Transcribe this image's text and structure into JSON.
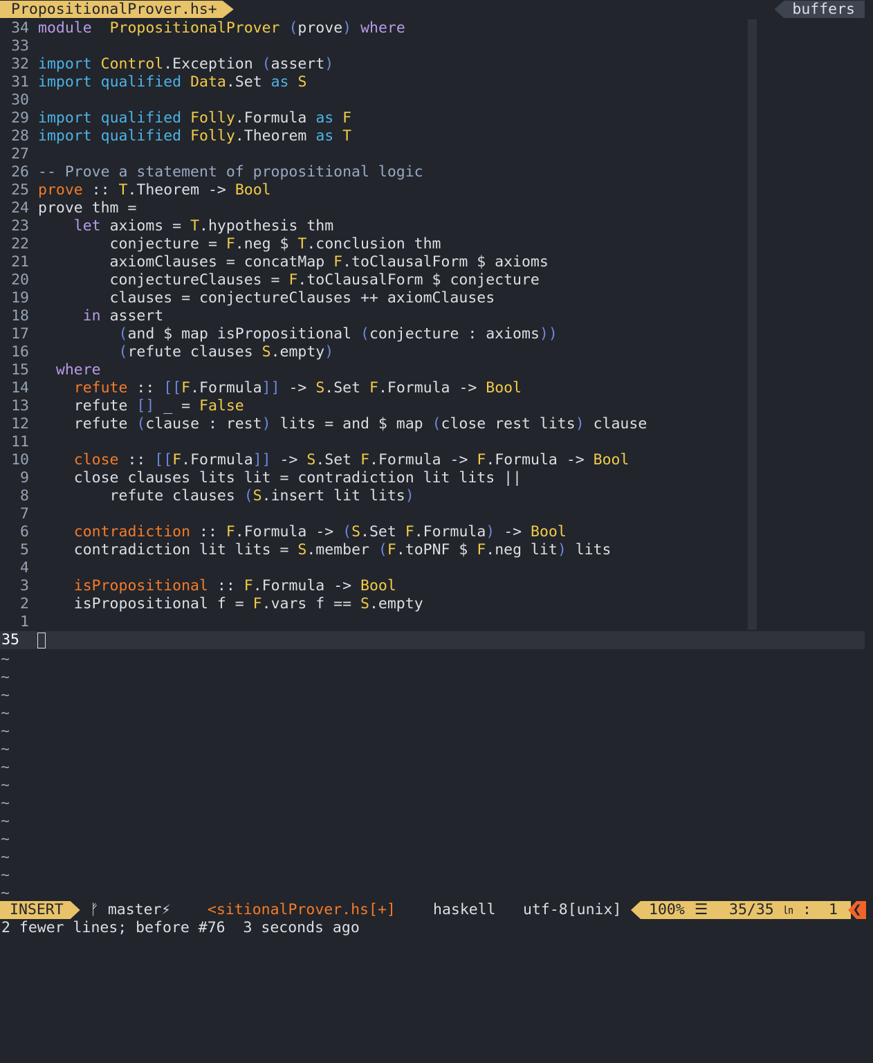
{
  "tabline": {
    "active_tab": "PropositionalProver.hs+",
    "buffers_label": "buffers"
  },
  "code": [
    {
      "ln": "34",
      "tokens": [
        [
          "kw",
          "module"
        ],
        [
          "",
          "  "
        ],
        [
          "ty",
          "PropositionalProver"
        ],
        [
          "",
          " "
        ],
        [
          "pu",
          "("
        ],
        [
          "",
          "prove"
        ],
        [
          "pu",
          ")"
        ],
        [
          "",
          " "
        ],
        [
          "kw",
          "where"
        ]
      ]
    },
    {
      "ln": "33",
      "tokens": []
    },
    {
      "ln": "32",
      "tokens": [
        [
          "im",
          "import"
        ],
        [
          "",
          " "
        ],
        [
          "ty",
          "Control"
        ],
        [
          "",
          ".Exception"
        ],
        [
          "",
          " "
        ],
        [
          "pu",
          "("
        ],
        [
          "",
          "assert"
        ],
        [
          "pu",
          ")"
        ]
      ]
    },
    {
      "ln": "31",
      "tokens": [
        [
          "im",
          "import"
        ],
        [
          "",
          " "
        ],
        [
          "im",
          "qualified"
        ],
        [
          "",
          " "
        ],
        [
          "ty",
          "Data"
        ],
        [
          "",
          ".Set"
        ],
        [
          "",
          " "
        ],
        [
          "im",
          "as"
        ],
        [
          "",
          " "
        ],
        [
          "ty",
          "S"
        ]
      ]
    },
    {
      "ln": "30",
      "tokens": []
    },
    {
      "ln": "29",
      "tokens": [
        [
          "im",
          "import"
        ],
        [
          "",
          " "
        ],
        [
          "im",
          "qualified"
        ],
        [
          "",
          " "
        ],
        [
          "ty",
          "Folly"
        ],
        [
          "",
          ".Formula"
        ],
        [
          "",
          " "
        ],
        [
          "im",
          "as"
        ],
        [
          "",
          " "
        ],
        [
          "ty",
          "F"
        ]
      ]
    },
    {
      "ln": "28",
      "tokens": [
        [
          "im",
          "import"
        ],
        [
          "",
          " "
        ],
        [
          "im",
          "qualified"
        ],
        [
          "",
          " "
        ],
        [
          "ty",
          "Folly"
        ],
        [
          "",
          ".Theorem"
        ],
        [
          "",
          " "
        ],
        [
          "im",
          "as"
        ],
        [
          "",
          " "
        ],
        [
          "ty",
          "T"
        ]
      ]
    },
    {
      "ln": "27",
      "tokens": []
    },
    {
      "ln": "26",
      "tokens": [
        [
          "cm",
          "-- Prove a statement of propositional logic"
        ]
      ]
    },
    {
      "ln": "25",
      "tokens": [
        [
          "fn",
          "prove"
        ],
        [
          "",
          " :: "
        ],
        [
          "ty",
          "T"
        ],
        [
          "",
          ".Theorem"
        ],
        [
          "",
          " -> "
        ],
        [
          "ty",
          "Bool"
        ]
      ]
    },
    {
      "ln": "24",
      "tokens": [
        [
          "",
          "prove thm ="
        ]
      ]
    },
    {
      "ln": "23",
      "tokens": [
        [
          "",
          "    "
        ],
        [
          "kw",
          "let"
        ],
        [
          "",
          " axioms = "
        ],
        [
          "ty",
          "T"
        ],
        [
          "",
          ".hypothesis thm"
        ]
      ]
    },
    {
      "ln": "22",
      "tokens": [
        [
          "",
          "        conjecture = "
        ],
        [
          "ty",
          "F"
        ],
        [
          "",
          ".neg $ "
        ],
        [
          "ty",
          "T"
        ],
        [
          "",
          ".conclusion thm"
        ]
      ]
    },
    {
      "ln": "21",
      "tokens": [
        [
          "",
          "        axiomClauses = concatMap "
        ],
        [
          "ty",
          "F"
        ],
        [
          "",
          ".toClausalForm $ axioms"
        ]
      ]
    },
    {
      "ln": "20",
      "tokens": [
        [
          "",
          "        conjectureClauses = "
        ],
        [
          "ty",
          "F"
        ],
        [
          "",
          ".toClausalForm $ conjecture"
        ]
      ]
    },
    {
      "ln": "19",
      "tokens": [
        [
          "",
          "        clauses = conjectureClauses ++ axiomClauses"
        ]
      ]
    },
    {
      "ln": "18",
      "tokens": [
        [
          "",
          "     "
        ],
        [
          "kw",
          "in"
        ],
        [
          "",
          " assert"
        ]
      ]
    },
    {
      "ln": "17",
      "tokens": [
        [
          "",
          "         "
        ],
        [
          "pu",
          "("
        ],
        [
          "",
          "and $ map isPropositional "
        ],
        [
          "pu",
          "("
        ],
        [
          "",
          "conjecture : axioms"
        ],
        [
          "pu",
          "))"
        ]
      ]
    },
    {
      "ln": "16",
      "tokens": [
        [
          "",
          "         "
        ],
        [
          "pu",
          "("
        ],
        [
          "",
          "refute clauses "
        ],
        [
          "ty",
          "S"
        ],
        [
          "",
          ".empty"
        ],
        [
          "pu",
          ")"
        ]
      ]
    },
    {
      "ln": "15",
      "tokens": [
        [
          "",
          "  "
        ],
        [
          "kw",
          "where"
        ]
      ]
    },
    {
      "ln": "14",
      "tokens": [
        [
          "",
          "    "
        ],
        [
          "fn",
          "refute"
        ],
        [
          "",
          " :: "
        ],
        [
          "pu",
          "[["
        ],
        [
          "ty",
          "F"
        ],
        [
          "",
          ".Formula"
        ],
        [
          "pu",
          "]]"
        ],
        [
          "",
          " -> "
        ],
        [
          "ty",
          "S"
        ],
        [
          "",
          ".Set "
        ],
        [
          "ty",
          "F"
        ],
        [
          "",
          ".Formula"
        ],
        [
          "",
          " -> "
        ],
        [
          "ty",
          "Bool"
        ]
      ]
    },
    {
      "ln": "13",
      "tokens": [
        [
          "",
          "    refute "
        ],
        [
          "pu",
          "[]"
        ],
        [
          "",
          " _ = "
        ],
        [
          "ty",
          "False"
        ]
      ]
    },
    {
      "ln": "12",
      "tokens": [
        [
          "",
          "    refute "
        ],
        [
          "pu",
          "("
        ],
        [
          "",
          "clause : rest"
        ],
        [
          "pu",
          ")"
        ],
        [
          "",
          " lits = and $ map "
        ],
        [
          "pu",
          "("
        ],
        [
          "",
          "close rest lits"
        ],
        [
          "pu",
          ")"
        ],
        [
          "",
          " clause"
        ]
      ]
    },
    {
      "ln": "11",
      "tokens": []
    },
    {
      "ln": "10",
      "tokens": [
        [
          "",
          "    "
        ],
        [
          "fn",
          "close"
        ],
        [
          "",
          " :: "
        ],
        [
          "pu",
          "[["
        ],
        [
          "ty",
          "F"
        ],
        [
          "",
          ".Formula"
        ],
        [
          "pu",
          "]]"
        ],
        [
          "",
          " -> "
        ],
        [
          "ty",
          "S"
        ],
        [
          "",
          ".Set "
        ],
        [
          "ty",
          "F"
        ],
        [
          "",
          ".Formula"
        ],
        [
          "",
          " -> "
        ],
        [
          "ty",
          "F"
        ],
        [
          "",
          ".Formula"
        ],
        [
          "",
          " -> "
        ],
        [
          "ty",
          "Bool"
        ]
      ]
    },
    {
      "ln": "9",
      "tokens": [
        [
          "",
          "    close clauses lits lit = contradiction lit lits ||"
        ]
      ]
    },
    {
      "ln": "8",
      "tokens": [
        [
          "",
          "        refute clauses "
        ],
        [
          "pu",
          "("
        ],
        [
          "ty",
          "S"
        ],
        [
          "",
          ".insert lit lits"
        ],
        [
          "pu",
          ")"
        ]
      ]
    },
    {
      "ln": "7",
      "tokens": []
    },
    {
      "ln": "6",
      "tokens": [
        [
          "",
          "    "
        ],
        [
          "fn",
          "contradiction"
        ],
        [
          "",
          " :: "
        ],
        [
          "ty",
          "F"
        ],
        [
          "",
          ".Formula"
        ],
        [
          "",
          " -> "
        ],
        [
          "pu",
          "("
        ],
        [
          "ty",
          "S"
        ],
        [
          "",
          ".Set "
        ],
        [
          "ty",
          "F"
        ],
        [
          "",
          ".Formula"
        ],
        [
          "pu",
          ")"
        ],
        [
          "",
          " -> "
        ],
        [
          "ty",
          "Bool"
        ]
      ]
    },
    {
      "ln": "5",
      "tokens": [
        [
          "",
          "    contradiction lit lits = "
        ],
        [
          "ty",
          "S"
        ],
        [
          "",
          ".member "
        ],
        [
          "pu",
          "("
        ],
        [
          "ty",
          "F"
        ],
        [
          "",
          ".toPNF $ "
        ],
        [
          "ty",
          "F"
        ],
        [
          "",
          ".neg lit"
        ],
        [
          "pu",
          ")"
        ],
        [
          "",
          " lits"
        ]
      ]
    },
    {
      "ln": "4",
      "tokens": []
    },
    {
      "ln": "3",
      "tokens": [
        [
          "",
          "    "
        ],
        [
          "fn",
          "isPropositional"
        ],
        [
          "",
          " :: "
        ],
        [
          "ty",
          "F"
        ],
        [
          "",
          ".Formula"
        ],
        [
          "",
          " -> "
        ],
        [
          "ty",
          "Bool"
        ]
      ]
    },
    {
      "ln": "2",
      "tokens": [
        [
          "",
          "    isPropositional f = "
        ],
        [
          "ty",
          "F"
        ],
        [
          "",
          ".vars f == "
        ],
        [
          "ty",
          "S"
        ],
        [
          "",
          ".empty"
        ]
      ]
    },
    {
      "ln": "1",
      "tokens": []
    }
  ],
  "cursor_line": {
    "ln": "35"
  },
  "tilde_count": 14,
  "tilde_char": "~",
  "statusline": {
    "mode": "INSERT",
    "branch_icon": "ᚠ",
    "branch": "master⚡",
    "filename": "<sitionalProver.hs[+]",
    "filetype": "haskell",
    "encoding": "utf-8[unix]",
    "percent": "100%",
    "menu_icon": "☰",
    "position": "35/35",
    "ln_icon": "㏑",
    "col_sep": ":",
    "column": "1",
    "warn_icon": "❮"
  },
  "message": "2 fewer lines; before #76  3 seconds ago",
  "colors": {
    "background": "#22252b",
    "accent": "#e8c36a",
    "keyword": "#b99be8",
    "import": "#4cb3e8",
    "type": "#f2cb4a",
    "function": "#f47b2b",
    "punct": "#6e88e0",
    "comment": "#9aa8c4"
  }
}
